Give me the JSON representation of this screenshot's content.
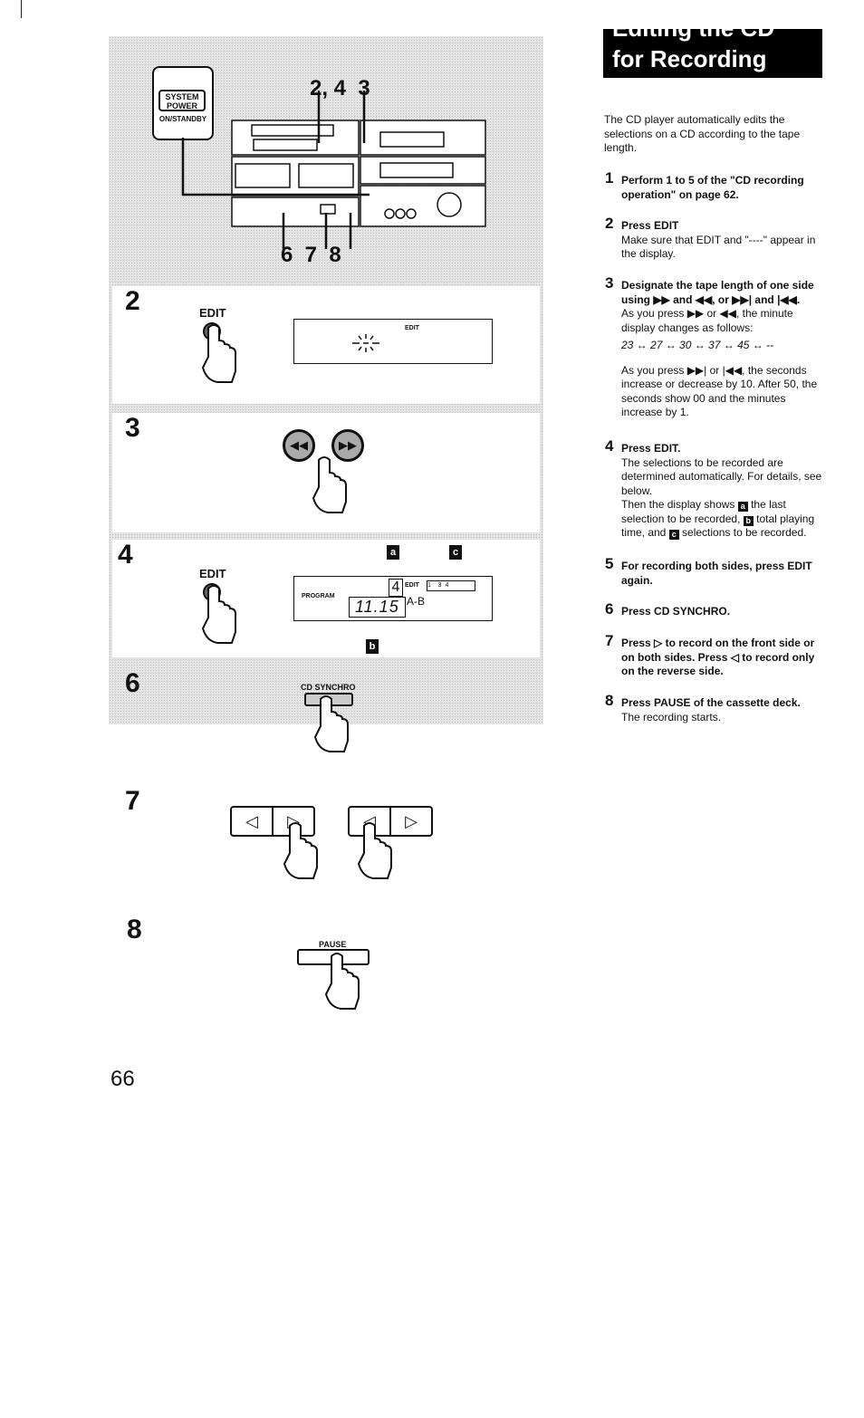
{
  "page": {
    "title_line1": "Editing the CD",
    "title_line2": "for Recording",
    "intro": "The CD player automatically edits the selections on a CD according to the tape length.",
    "page_number": "66"
  },
  "steps": [
    {
      "num": "1",
      "heading": "Perform 1 to 5 of the \"CD recording operation\" on page 62.",
      "body": []
    },
    {
      "num": "2",
      "heading": "Press EDIT",
      "body": [
        "Make sure that EDIT and \"----\" appear in the display."
      ]
    },
    {
      "num": "3",
      "heading": "Designate the tape length of one side using ▶▶ and ◀◀, or ▶▶| and |◀◀.",
      "body": [
        "As you press ▶▶ or ◀◀, the minute display changes as follows:",
        "23 ↔ 27 ↔ 30 ↔ 37 ↔ 45 ↔ --",
        "As you press ▶▶| or |◀◀, the seconds increase  or decrease by 10.  After 50, the seconds show 00 and the minutes increase by 1."
      ]
    },
    {
      "num": "4",
      "heading": "Press EDIT.",
      "body": [
        "The selections to be recorded are determined automatically.  For details, see below."
      ],
      "detail": {
        "pre": "Then the display shows",
        "a": "a",
        "a_text": "the last selection to be recorded,",
        "b": "b",
        "b_text": "total playing time, and",
        "c": "c",
        "c_text": "selections to be recorded."
      }
    },
    {
      "num": "5",
      "heading": "For recording both sides, press EDIT again.",
      "body": []
    },
    {
      "num": "6",
      "heading": "Press CD SYNCHRO.",
      "body": []
    },
    {
      "num": "7",
      "heading": "Press ▷ to record on the front side or on both sides. Press ◁ to record only on the reverse side.",
      "body": []
    },
    {
      "num": "8",
      "heading": "Press PAUSE of the cassette deck.",
      "body": [
        "The recording starts."
      ]
    }
  ],
  "illustration": {
    "system_power_label": "SYSTEM POWER",
    "system_power_sub": "ON/STANDBY",
    "callout_top": "2, 4  3",
    "callout_bottom": "6  7  8",
    "panel_steps": [
      "2",
      "3",
      "4",
      "6",
      "7",
      "8"
    ],
    "edit_label": "EDIT",
    "display_edit": "EDIT",
    "display_program": "PROGRAM",
    "display_time": "11.15",
    "display_track": "4",
    "display_ab": "A-B",
    "display_tracks": "1    3  4",
    "callout_a": "a",
    "callout_b": "b",
    "callout_c": "c",
    "cd_synchro_label": "CD SYNCHRO",
    "pause_label": "PAUSE"
  }
}
